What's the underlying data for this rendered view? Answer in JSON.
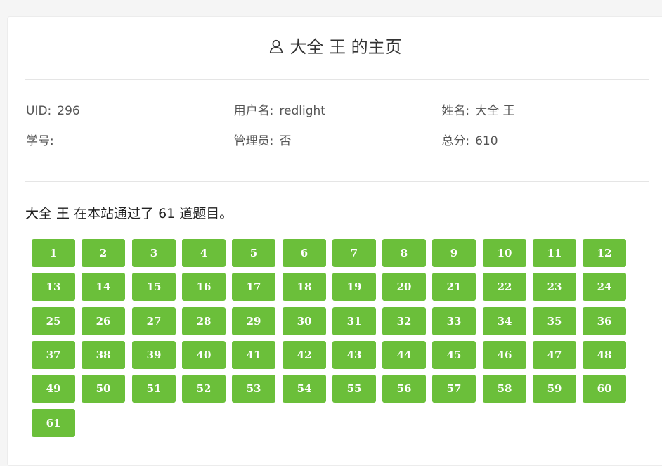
{
  "header": {
    "icon": "user-icon",
    "title": "大全 王 的主页"
  },
  "info": {
    "uid_label": "UID:",
    "uid_value": "296",
    "username_label": "用户名:",
    "username_value": "redlight",
    "name_label": "姓名:",
    "name_value": "大全 王",
    "student_id_label": "学号:",
    "student_id_value": "",
    "admin_label": "管理员:",
    "admin_value": "否",
    "score_label": "总分:",
    "score_value": "610"
  },
  "summary": {
    "name": "大全 王",
    "prefix": "在本站通过了",
    "count": "61",
    "suffix": "道题目。"
  },
  "colors": {
    "problem_button": "#6bbf3a"
  },
  "solved_problems": [
    "1",
    "2",
    "3",
    "4",
    "5",
    "6",
    "7",
    "8",
    "9",
    "10",
    "11",
    "12",
    "13",
    "14",
    "15",
    "16",
    "17",
    "18",
    "19",
    "20",
    "21",
    "22",
    "23",
    "24",
    "25",
    "26",
    "27",
    "28",
    "29",
    "30",
    "31",
    "32",
    "33",
    "34",
    "35",
    "36",
    "37",
    "38",
    "39",
    "40",
    "41",
    "42",
    "43",
    "44",
    "45",
    "46",
    "47",
    "48",
    "49",
    "50",
    "51",
    "52",
    "53",
    "54",
    "55",
    "56",
    "57",
    "58",
    "59",
    "60",
    "61"
  ]
}
